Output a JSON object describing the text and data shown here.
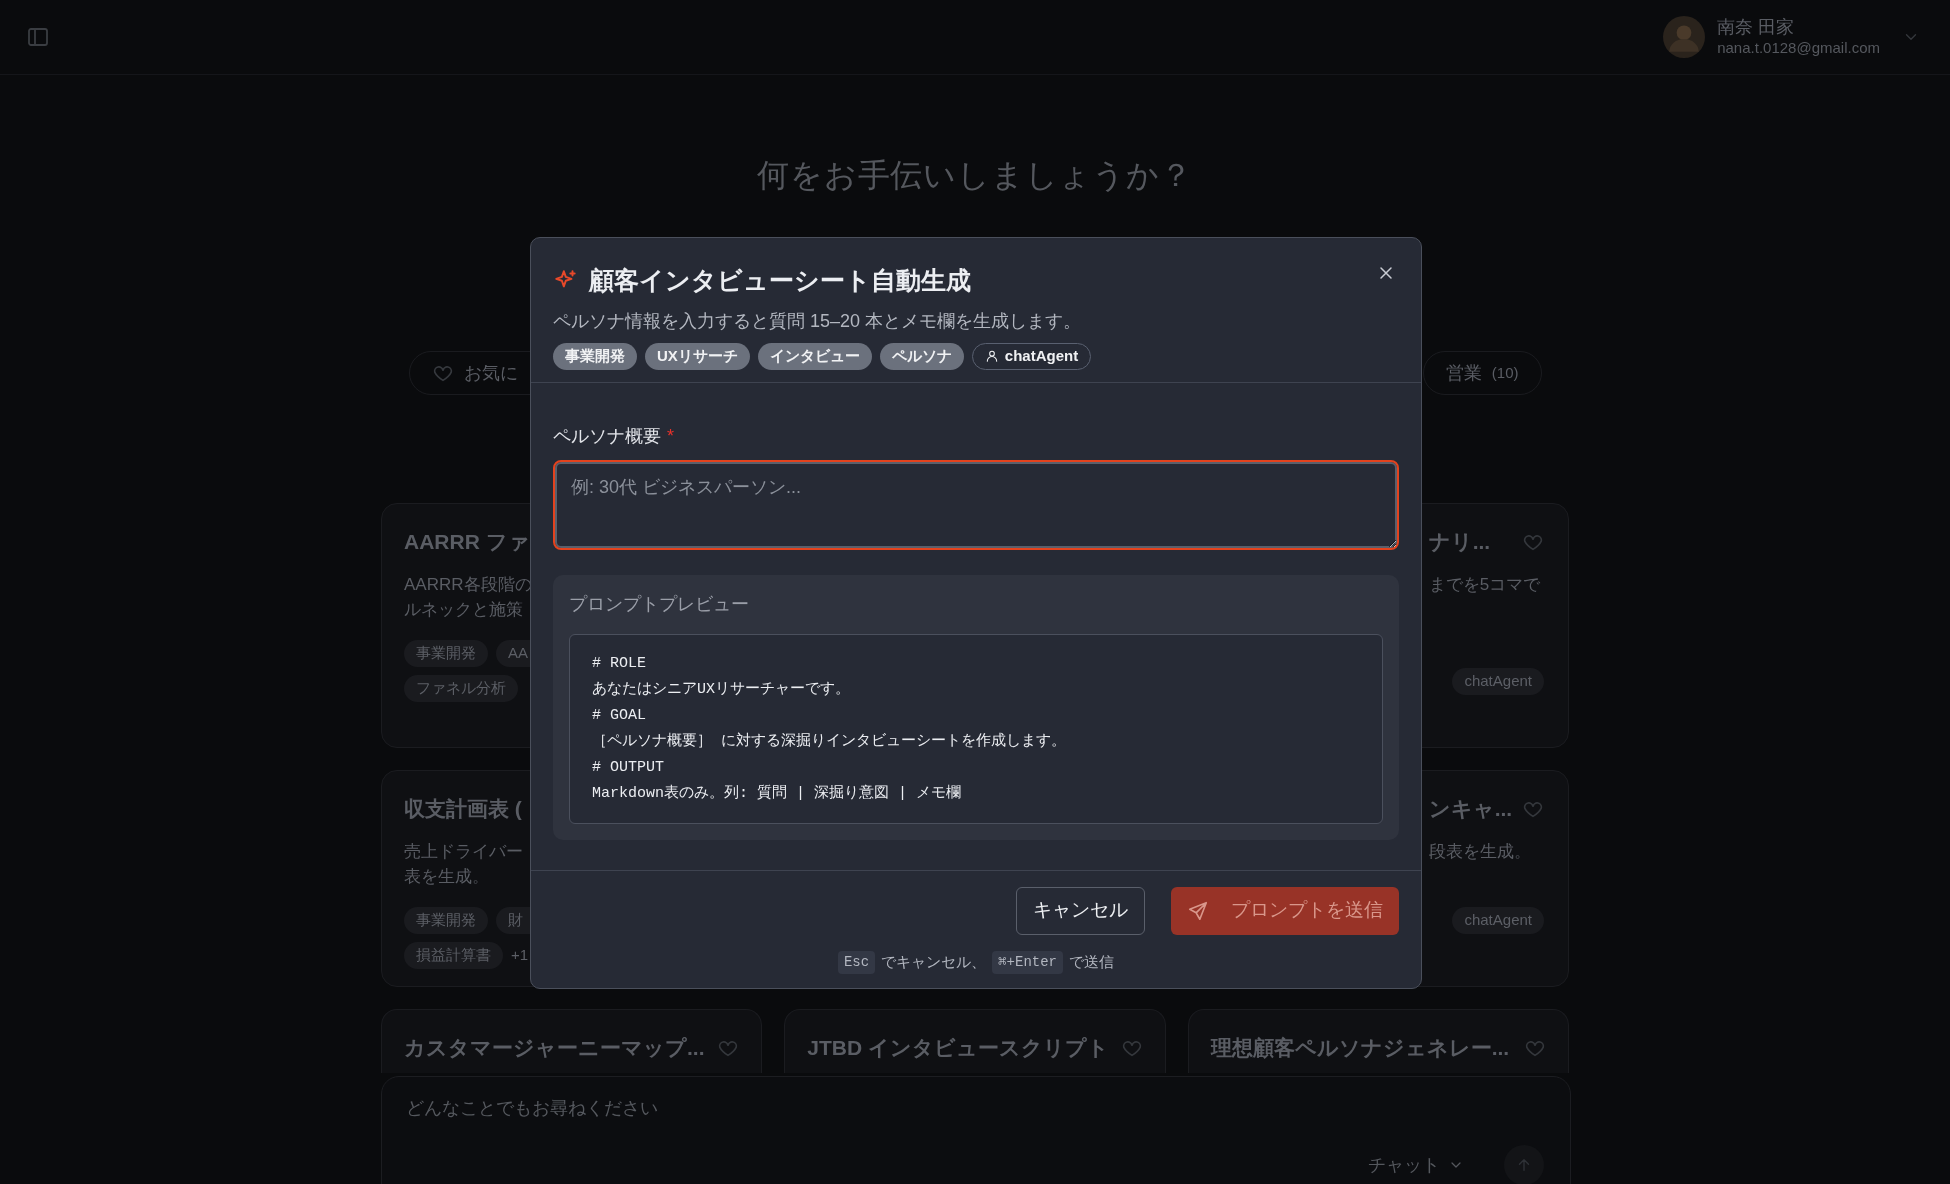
{
  "top_bar": {
    "user": {
      "name": "南奈 田家",
      "email": "nana.t.0128@gmail.com"
    }
  },
  "heading": "何をお手伝いしましょうか？",
  "filter_chips": [
    {
      "kind": "favorites",
      "label": "お気に"
    },
    {
      "kind": "category",
      "label": "営業",
      "count": "(10)"
    }
  ],
  "card_rows": [
    {
      "left": {
        "title": "AARRR ファ",
        "description": [
          "AARRR各段階の",
          "ルネックと施策"
        ],
        "tags": [
          "事業開発",
          "AA",
          "ファネル分析"
        ]
      },
      "right": {
        "title": "ナリ...",
        "favorite": false,
        "description": [
          "までを5コマで"
        ],
        "tags": [
          "chatAgent"
        ]
      }
    },
    {
      "left": {
        "title": "収支計画表 (",
        "description": [
          "売上ドライバー",
          "表を生成。"
        ],
        "tags": [
          "事業開発",
          "財",
          "損益計算書"
        ],
        "more": "+1"
      },
      "right": {
        "title": "ンキャ...",
        "favorite": false,
        "description": [
          "段表を生成。"
        ],
        "tags": [
          "chatAgent"
        ]
      }
    },
    {
      "left": {
        "title": "カスタマージャーニーマップ...",
        "favorite": false
      },
      "middle": {
        "title": "JTBD インタビュースクリプト",
        "favorite": false
      },
      "right": {
        "title": "理想顧客ペルソナジェネレー...",
        "favorite": false
      }
    }
  ],
  "chat_input": {
    "placeholder": "どんなことでもお尋ねください",
    "mode": "チャット"
  },
  "modal": {
    "title": "顧客インタビューシート自動生成",
    "subtitle": "ペルソナ情報を入力すると質問 15–20 本とメモ欄を生成します。",
    "tags": [
      {
        "kind": "tag",
        "label": "事業開発"
      },
      {
        "kind": "tag",
        "label": "UXリサーチ"
      },
      {
        "kind": "tag",
        "label": "インタビュー"
      },
      {
        "kind": "tag",
        "label": "ペルソナ"
      },
      {
        "kind": "agent",
        "label": "chatAgent"
      }
    ],
    "field": {
      "label": "ペルソナ概要",
      "required_mark": "*",
      "placeholder": "例: 30代 ビジネスパーソン...",
      "focused": true
    },
    "preview": {
      "label": "プロンプトプレビュー",
      "lines": [
        "# ROLE",
        "あなたはシニアUXリサーチャーです。",
        "# GOAL",
        "［ペルソナ概要］ に対する深掘りインタビューシートを作成します。",
        "# OUTPUT",
        "Markdown表のみ。列: 質問 | 深掘り意図 | メモ欄"
      ]
    },
    "cancel_button": "キャンセル",
    "send_button": {
      "label": "プロンプトを送信",
      "disabled": true
    },
    "hint": [
      {
        "kind": "key",
        "text": "Esc"
      },
      {
        "kind": "text",
        "text": "でキャンセル、"
      },
      {
        "kind": "key",
        "text": "⌘+Enter"
      },
      {
        "kind": "text",
        "text": "で送信"
      }
    ]
  }
}
